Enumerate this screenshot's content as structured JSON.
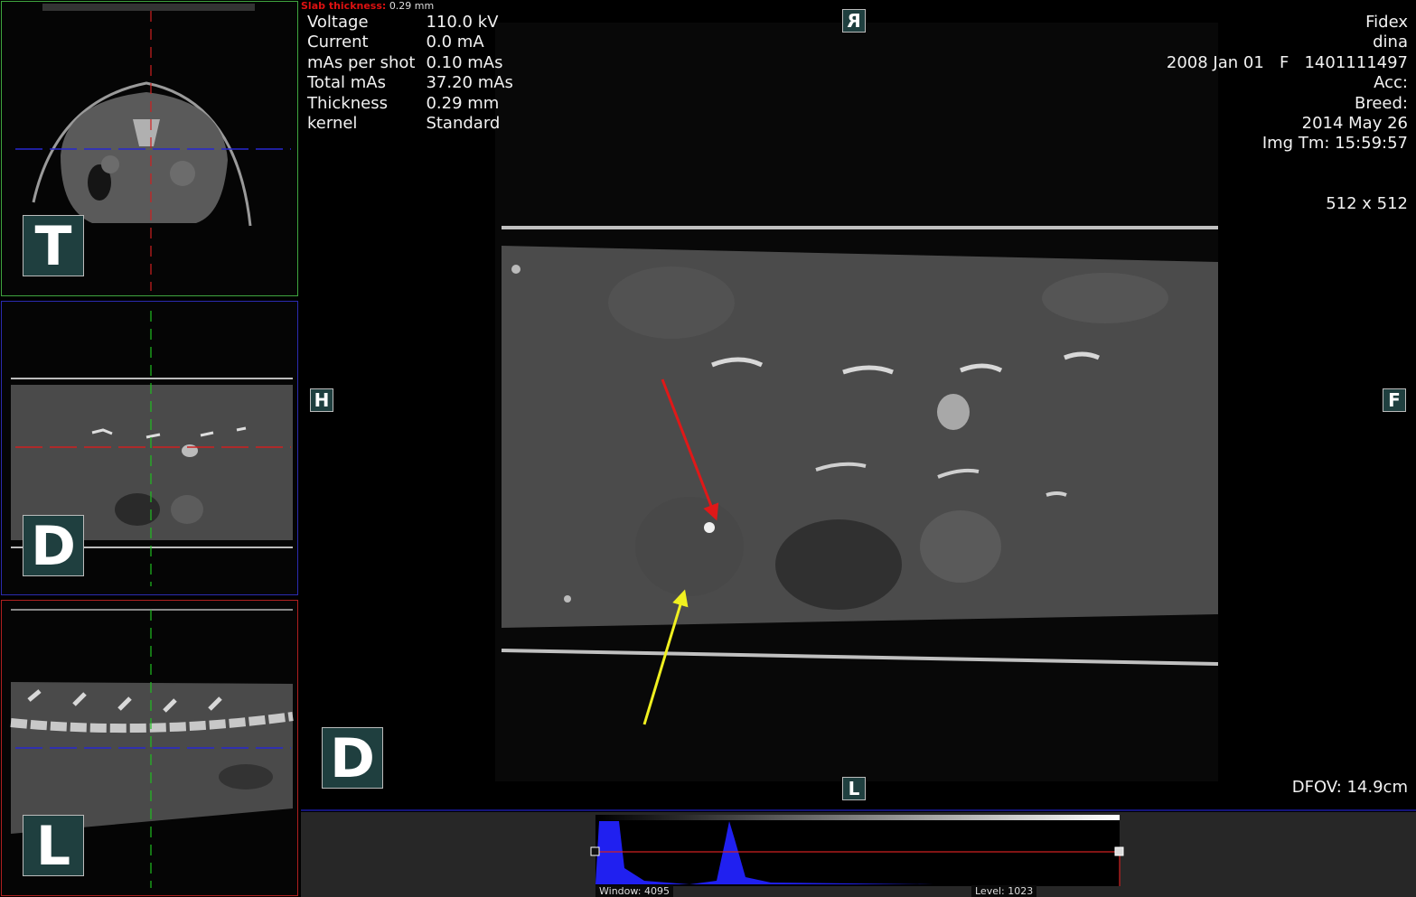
{
  "slab": {
    "label": "Slab thickness:",
    "value": "0.29 mm"
  },
  "acquisition": [
    {
      "label": "Voltage",
      "value": "110.0 kV"
    },
    {
      "label": "Current",
      "value": "0.0 mA"
    },
    {
      "label": "mAs per shot",
      "value": "0.10 mAs"
    },
    {
      "label": "Total mAs",
      "value": "37.20 mAs"
    },
    {
      "label": "Thickness",
      "value": "0.29 mm"
    },
    {
      "label": "kernel",
      "value": "Standard"
    }
  ],
  "patient": {
    "line1": "Fidex",
    "line2": "dina",
    "line3": "2008 Jan 01   F   1401111497",
    "line4": "Acc:",
    "line5": "Breed:",
    "line6": "2014 May 26",
    "line7": "Img Tm: 15:59:57"
  },
  "matrix": "512 x 512",
  "dfov": "DFOV: 14.9cm",
  "views": {
    "top_label": "T",
    "middle_label": "D",
    "bottom_label": "L",
    "main_label": "D"
  },
  "orientation": {
    "top": "R",
    "bottom": "L",
    "left": "H",
    "right": "F"
  },
  "window_level": {
    "window": "Window: 4095",
    "level": "Level: 1023"
  },
  "colors": {
    "accent_red": "#e01818",
    "accent_yellow": "#f0f020",
    "histogram": "#2020f0",
    "crosshair_green": "#20c020",
    "crosshair_blue": "#2020d0"
  }
}
